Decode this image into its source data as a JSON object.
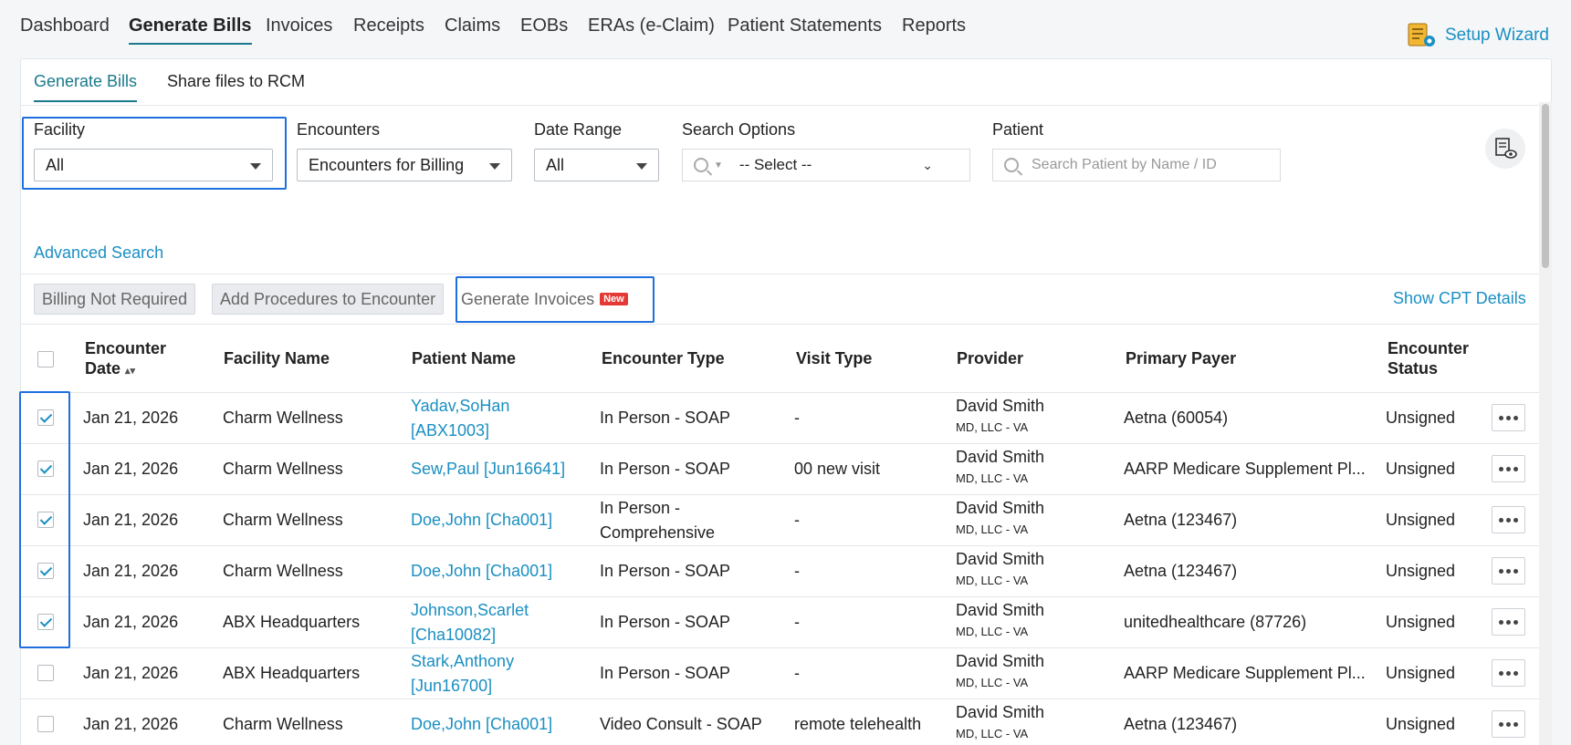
{
  "topnav": {
    "items": [
      "Dashboard",
      "Generate Bills",
      "Invoices",
      "Receipts",
      "Claims",
      "EOBs",
      "ERAs (e-Claim)",
      "Patient Statements",
      "Reports"
    ],
    "active": "Generate Bills",
    "setup_wizard": "Setup Wizard"
  },
  "subtabs": [
    "Generate Bills",
    "Share files to RCM"
  ],
  "filters": {
    "facility": {
      "label": "Facility",
      "value": "All"
    },
    "encounters": {
      "label": "Encounters",
      "value": "Encounters for Billing"
    },
    "date_range": {
      "label": "Date Range",
      "value": "All"
    },
    "search_options": {
      "label": "Search Options",
      "value": "-- Select --"
    },
    "patient": {
      "label": "Patient",
      "placeholder": "Search Patient by Name / ID"
    }
  },
  "advanced_search": "Advanced Search",
  "actions": {
    "billing_not_required": "Billing Not Required",
    "add_procedures": "Add Procedures to Encounter",
    "generate_invoices": "Generate Invoices",
    "new_badge": "New",
    "show_cpt": "Show CPT Details"
  },
  "table": {
    "headers": {
      "encounter_date_1": "Encounter",
      "encounter_date_2": "Date",
      "facility": "Facility Name",
      "patient": "Patient Name",
      "encounter_type": "Encounter Type",
      "visit_type": "Visit Type",
      "provider": "Provider",
      "primary_payer": "Primary Payer",
      "status_1": "Encounter",
      "status_2": "Status"
    },
    "rows": [
      {
        "checked": true,
        "date": "Jan 21, 2026",
        "facility": "Charm Wellness",
        "patient_1": "Yadav,SoHan",
        "patient_2": "[ABX1003]",
        "type_1": "In Person - SOAP",
        "type_2": "",
        "visit": "-",
        "provider": "David Smith",
        "provider_sub": "MD, LLC - VA",
        "payer": "Aetna (60054)",
        "status": "Unsigned"
      },
      {
        "checked": true,
        "date": "Jan 21, 2026",
        "facility": "Charm Wellness",
        "patient_1": "Sew,Paul [Jun16641]",
        "patient_2": "",
        "type_1": "In Person - SOAP",
        "type_2": "",
        "visit": "00 new visit",
        "provider": "David Smith",
        "provider_sub": "MD, LLC - VA",
        "payer": "AARP Medicare Supplement Pl...",
        "status": "Unsigned"
      },
      {
        "checked": true,
        "date": "Jan 21, 2026",
        "facility": "Charm Wellness",
        "patient_1": "Doe,John [Cha001]",
        "patient_2": "",
        "type_1": "In Person -",
        "type_2": "Comprehensive",
        "visit": "-",
        "provider": "David Smith",
        "provider_sub": "MD, LLC - VA",
        "payer": "Aetna (123467)",
        "status": "Unsigned"
      },
      {
        "checked": true,
        "date": "Jan 21, 2026",
        "facility": "Charm Wellness",
        "patient_1": "Doe,John [Cha001]",
        "patient_2": "",
        "type_1": "In Person - SOAP",
        "type_2": "",
        "visit": "-",
        "provider": "David Smith",
        "provider_sub": "MD, LLC - VA",
        "payer": "Aetna (123467)",
        "status": "Unsigned"
      },
      {
        "checked": true,
        "date": "Jan 21, 2026",
        "facility": "ABX Headquarters",
        "patient_1": "Johnson,Scarlet",
        "patient_2": "[Cha10082]",
        "type_1": "In Person - SOAP",
        "type_2": "",
        "visit": "-",
        "provider": "David Smith",
        "provider_sub": "MD, LLC - VA",
        "payer": "unitedhealthcare (87726)",
        "status": "Unsigned"
      },
      {
        "checked": false,
        "date": "Jan 21, 2026",
        "facility": "ABX Headquarters",
        "patient_1": "Stark,Anthony",
        "patient_2": "[Jun16700]",
        "type_1": "In Person - SOAP",
        "type_2": "",
        "visit": "-",
        "provider": "David Smith",
        "provider_sub": "MD, LLC - VA",
        "payer": "AARP Medicare Supplement Pl...",
        "status": "Unsigned"
      },
      {
        "checked": false,
        "date": "Jan 21, 2026",
        "facility": "Charm Wellness",
        "patient_1": "Doe,John [Cha001]",
        "patient_2": "",
        "type_1": "Video Consult - SOAP",
        "type_2": "",
        "visit": "remote telehealth",
        "provider": "David Smith",
        "provider_sub": "MD, LLC - VA",
        "payer": "Aetna (123467)",
        "status": "Unsigned"
      }
    ]
  },
  "colors": {
    "accent": "#1a7a8c",
    "link": "#1a8fc2",
    "highlight": "#1f6fe0",
    "badge": "#e53935"
  }
}
